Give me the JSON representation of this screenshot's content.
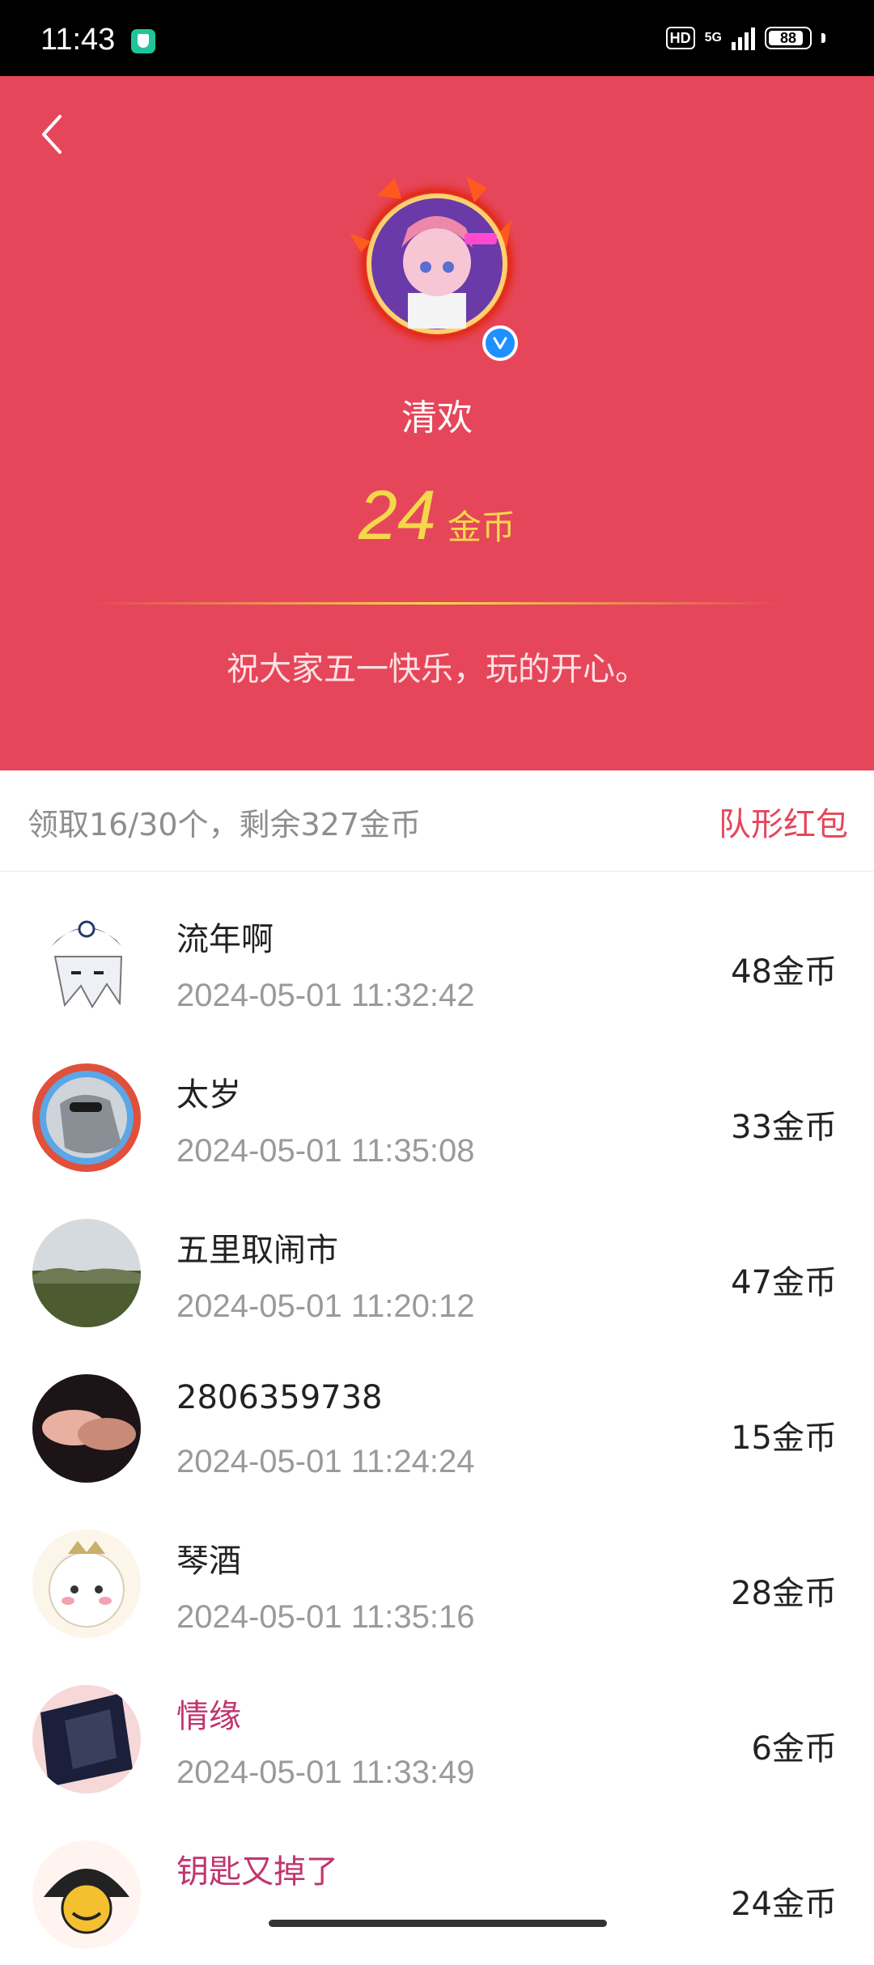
{
  "status_bar": {
    "time": "11:43",
    "hd": "HD",
    "network": "5G",
    "battery": "88",
    "battery_fraction": 0.88
  },
  "header": {
    "sender_name": "清欢",
    "amount": "24",
    "amount_unit": "金币",
    "blessing": "祝大家五一快乐，玩的开心。",
    "background_color": "#e6465a",
    "amount_color": "#f5d84a"
  },
  "summary": {
    "text": "领取16/30个，剩余327金币",
    "type_label": "队形红包"
  },
  "records": [
    {
      "name": "流年啊",
      "time": "2024-05-01 11:32:42",
      "amount": "48金币"
    },
    {
      "name": "太岁",
      "time": "2024-05-01 11:35:08",
      "amount": "33金币"
    },
    {
      "name": "五里取闹市",
      "time": "2024-05-01 11:20:12",
      "amount": "47金币"
    },
    {
      "name": "2806359738",
      "time": "2024-05-01 11:24:24",
      "amount": "15金币"
    },
    {
      "name": "琴酒",
      "time": "2024-05-01 11:35:16",
      "amount": "28金币"
    },
    {
      "name": "情缘",
      "time": "2024-05-01 11:33:49",
      "amount": "6金币"
    },
    {
      "name": "钥匙又掉了",
      "time": "",
      "amount": "24金币"
    }
  ],
  "icons": {
    "back": "back-arrow-icon",
    "verified": "verified-badge-icon"
  }
}
